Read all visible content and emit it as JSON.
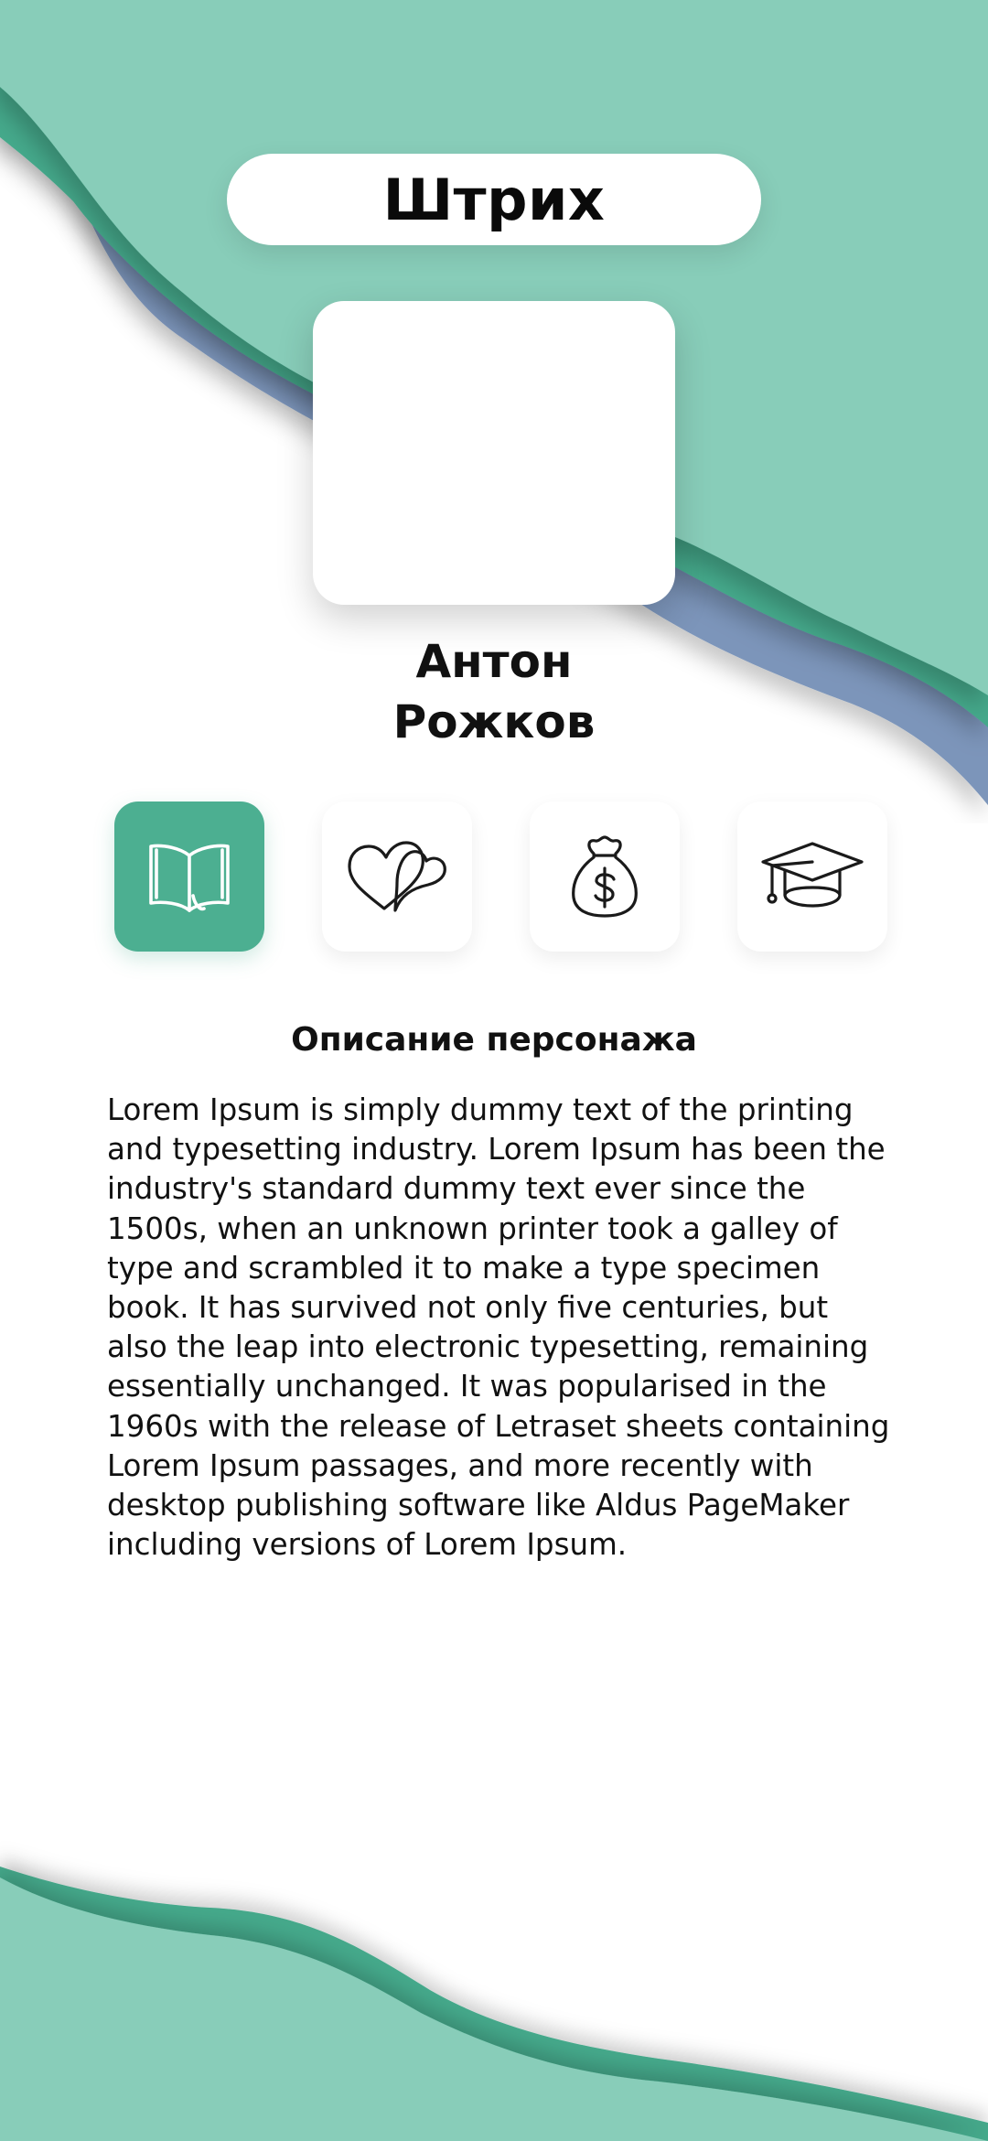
{
  "header": {
    "title": "Штрих"
  },
  "character": {
    "first_name": "Антон",
    "last_name": "Рожков"
  },
  "tabs": [
    {
      "icon": "open-book-icon",
      "active": true
    },
    {
      "icon": "hearts-icon",
      "active": false
    },
    {
      "icon": "money-bag-icon",
      "active": false
    },
    {
      "icon": "graduation-cap-icon",
      "active": false
    }
  ],
  "description": {
    "title": "Описание персонажа",
    "text": "Lorem Ipsum is simply dummy text of the printing and typesetting industry. Lorem Ipsum has been the industry's standard dummy text ever since the 1500s, when an unknown printer took a galley of type and scrambled it to make a type specimen book. It has survived not only five centuries, but also the leap into electronic typesetting, remaining essentially unchanged. It was popularised in the 1960s with the release of Letraset sheets containing Lorem Ipsum passages, and more recently with desktop publishing software like Aldus PageMaker including versions of Lorem Ipsum."
  },
  "colors": {
    "accent": "#4caf91",
    "wave_light": "#88cdb9",
    "wave_mid": "#45a98b",
    "wave_blue": "#7b95ba",
    "background": "#ffffff"
  }
}
